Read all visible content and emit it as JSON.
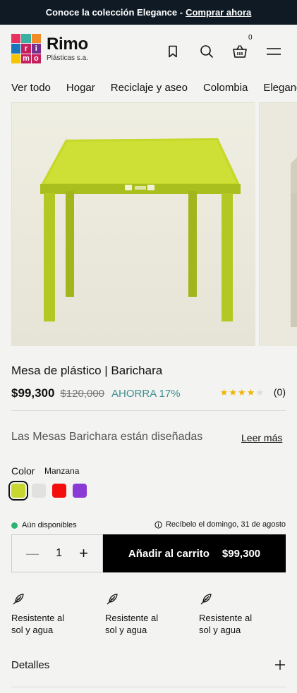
{
  "announcement": {
    "text": "Conoce la colección Elegance -",
    "link": "Comprar ahora"
  },
  "brand": {
    "name": "Rimo",
    "sub": "Plásticas s.a.",
    "logo_letters": [
      "r",
      "i",
      "m",
      "o"
    ],
    "logo_colors": [
      "#e6335f",
      "#3ab0a3",
      "#f28c28",
      "#1b75bc",
      "#f6c400",
      "#7a2e8c",
      "#c51f5d",
      "#2a9d8f",
      "#f6c400"
    ]
  },
  "header": {
    "cart_count": "0"
  },
  "nav": [
    "Ver todo",
    "Hogar",
    "Reciclaje y aseo",
    "Colombia",
    "Elegance"
  ],
  "product": {
    "title": "Mesa de plástico | Barichara",
    "price": "$99,300",
    "old_price": "$120,000",
    "savings": "AHORRA 17%",
    "rating": 4,
    "rating_max": 5,
    "review_count": "(0)",
    "description": "Las Mesas Barichara están diseñadas",
    "read_more": "Leer más",
    "color_label": "Color",
    "color_value": "Manzana",
    "swatches": [
      "#c8d630",
      "#e1e2e0",
      "#f40d0d",
      "#8a3bd6"
    ],
    "availability": "Aún disponibles",
    "delivery": "Recíbelo el domingo, 31 de agosto",
    "quantity": "1",
    "add_to_cart": "Añadir al carrito",
    "add_price": "$99,300"
  },
  "features": [
    {
      "text": "Resistente al sol y agua",
      "icon": "feather-icon"
    },
    {
      "text": "Resistente al sol y agua",
      "icon": "feather-icon"
    },
    {
      "text": "Resistente al sol y agua",
      "icon": "feather-icon"
    }
  ],
  "details_label": "Detalles"
}
